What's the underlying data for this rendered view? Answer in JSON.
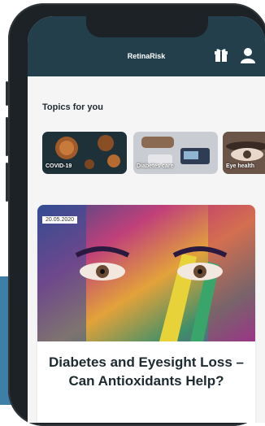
{
  "header": {
    "title": "RetinaRisk",
    "gift_icon": "gift-icon",
    "user_icon": "user-icon"
  },
  "topics": {
    "heading": "Topics for you",
    "items": [
      {
        "label": "COVID-19"
      },
      {
        "label": "Diabetes care"
      },
      {
        "label": "Eye health"
      }
    ]
  },
  "article": {
    "date": "20.05.2020",
    "title": "Diabetes and Eyesight Loss – Can Antioxidants Help?"
  },
  "colors": {
    "header_bg": "#233f4b",
    "screen_bg": "#f4f5f4",
    "promo_panel": "#3d7fa6"
  }
}
